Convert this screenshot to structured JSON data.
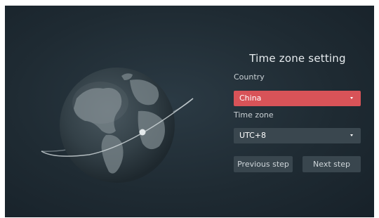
{
  "setting": {
    "title": "Time zone setting",
    "country_label": "Country",
    "country_value": "China",
    "timezone_label": "Time zone",
    "timezone_value": "UTC+8"
  },
  "buttons": {
    "previous": "Previous step",
    "next": "Next step"
  },
  "colors": {
    "accent": "#d85358",
    "background": "#1f2b33",
    "control": "#39464e"
  },
  "icons": {
    "globe": "globe-icon",
    "dropdown": "caret-down-icon"
  }
}
